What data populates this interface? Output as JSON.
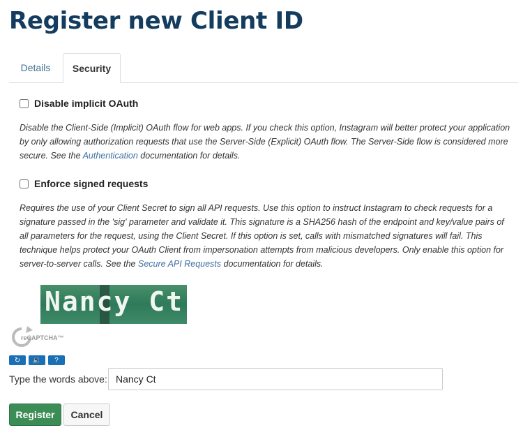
{
  "page": {
    "title": "Register new Client ID"
  },
  "tabs": [
    {
      "label": "Details",
      "active": false
    },
    {
      "label": "Security",
      "active": true
    }
  ],
  "options": {
    "implicit": {
      "label": "Disable implicit OAuth",
      "checked": false,
      "desc_before": "Disable the Client-Side (Implicit) OAuth flow for web apps. If you check this option, Instagram will better protect your application by only allowing authorization requests that use the Server-Side (Explicit) OAuth flow. The Server-Side flow is considered more secure. See the ",
      "link": "Authentication",
      "desc_after": " documentation for details."
    },
    "signed": {
      "label": "Enforce signed requests",
      "checked": false,
      "desc_before": "Requires the use of your Client Secret to sign all API requests. Use this option to instruct Instagram to check requests for a signature passed in the 'sig' parameter and validate it. This signature is a SHA256 hash of the endpoint and key/value pairs of all parameters for the request, using the Client Secret. If this option is set, calls with mismatched signatures will fail. This technique helps protect your OAuth Client from impersonation attempts from malicious developers. Only enable this option for server-to-server calls. See the ",
      "link": "Secure API Requests",
      "desc_after": " documentation for details."
    }
  },
  "captcha": {
    "image_text": "Nancy Ct",
    "logo_text": "reCAPTCHA™",
    "prompt": "Type the words above:",
    "value": "Nancy Ct"
  },
  "actions": {
    "register": "Register",
    "cancel": "Cancel"
  },
  "colors": {
    "title": "#143c5f",
    "link": "#3f6f9f",
    "register": "#3c8d55",
    "captcha_buttons": "#1a6fb5"
  }
}
